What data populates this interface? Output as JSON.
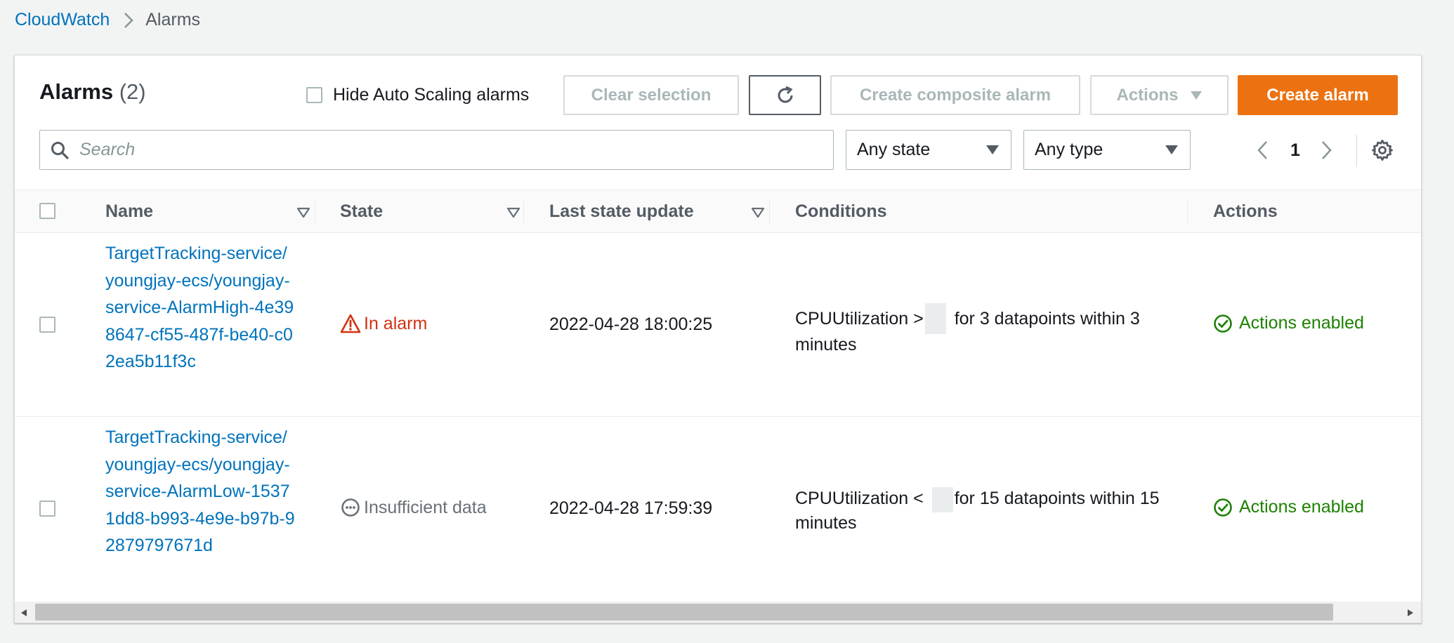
{
  "breadcrumb": {
    "root": "CloudWatch",
    "current": "Alarms"
  },
  "panel": {
    "title": "Alarms",
    "count": "(2)",
    "hide_autoscaling_label": "Hide Auto Scaling alarms",
    "hide_autoscaling_checked": false
  },
  "toolbar": {
    "clear_selection": "Clear selection",
    "refresh_icon": "refresh-icon",
    "create_composite": "Create composite alarm",
    "actions": "Actions",
    "create_alarm": "Create alarm"
  },
  "filters": {
    "search_placeholder": "Search",
    "state_selected": "Any state",
    "type_selected": "Any type"
  },
  "pagination": {
    "current_page": "1"
  },
  "table": {
    "columns": [
      "Name",
      "State",
      "Last state update",
      "Conditions",
      "Actions"
    ],
    "rows": [
      {
        "name": "TargetTracking-service/youngjay-ecs/youngjay-service-AlarmHigh-4e398647-cf55-487f-be40-c02ea5b11f3c",
        "state": "In alarm",
        "state_icon": "warning-triangle-icon",
        "last_update": "2022-04-28 18:00:25",
        "condition_prefix": "CPUUtilization >",
        "condition_suffix": "for 3 datapoints within 3 minutes",
        "actions": "Actions enabled"
      },
      {
        "name": "TargetTracking-service/youngjay-ecs/youngjay-service-AlarmLow-15371dd8-b993-4e9e-b97b-92879797671d",
        "state": "Insufficient data",
        "state_icon": "ellipsis-circle-icon",
        "last_update": "2022-04-28 17:59:39",
        "condition_prefix": "CPUUtilization <",
        "condition_suffix": "for 15 datapoints within 15 minutes",
        "actions": "Actions enabled"
      }
    ]
  },
  "colors": {
    "link": "#0073bb",
    "primary_button": "#ec7211",
    "alarm_red": "#d13212",
    "success_green": "#1d8102",
    "muted_gray": "#687078"
  }
}
